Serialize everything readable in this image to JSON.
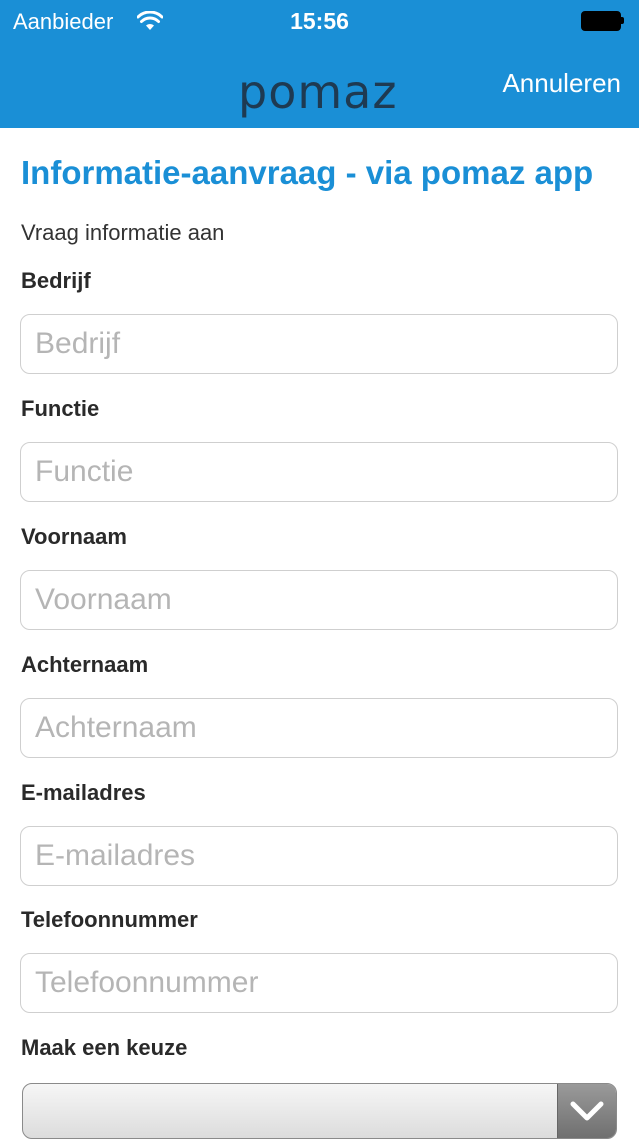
{
  "status_bar": {
    "carrier": "Aanbieder",
    "time": "15:56"
  },
  "navbar": {
    "logo_text": "pomaz",
    "cancel_label": "Annuleren"
  },
  "form": {
    "title": "Informatie-aanvraag - via pomaz app",
    "subtitle": "Vraag informatie aan",
    "fields": [
      {
        "label": "Bedrijf",
        "placeholder": "Bedrijf",
        "value": ""
      },
      {
        "label": "Functie",
        "placeholder": "Functie",
        "value": ""
      },
      {
        "label": "Voornaam",
        "placeholder": "Voornaam",
        "value": ""
      },
      {
        "label": "Achternaam",
        "placeholder": "Achternaam",
        "value": ""
      },
      {
        "label": "E-mailadres",
        "placeholder": "E-mailadres",
        "value": ""
      },
      {
        "label": "Telefoonnummer",
        "placeholder": "Telefoonnummer",
        "value": ""
      }
    ],
    "choice": {
      "label": "Maak een keuze",
      "selected": ""
    }
  },
  "colors": {
    "brand_blue": "#1a8fd6",
    "logo_dark": "#1e3a52"
  },
  "icons": {
    "wifi": "wifi-icon",
    "battery": "battery-icon",
    "dropdown": "chevron-down-icon"
  }
}
